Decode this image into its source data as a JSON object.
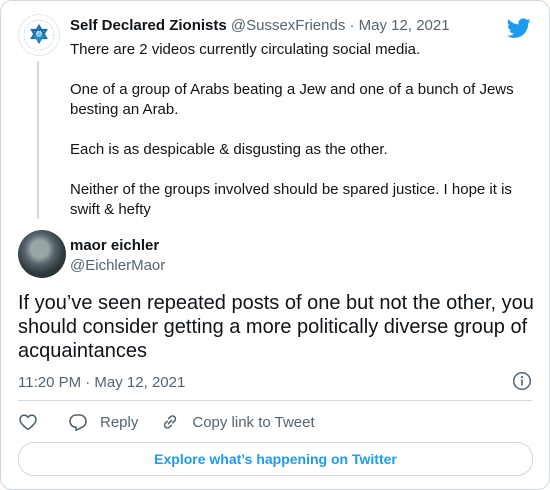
{
  "parent_tweet": {
    "display_name": "Self Declared Zionists",
    "handle": "@SussexFriends",
    "separator": "·",
    "date": "May 12, 2021",
    "avatar_icon": "star-of-david-logo",
    "paragraphs": [
      "There are 2 videos currently circulating social media.",
      "One of a group of Arabs beating a Jew and one of a bunch of Jews besting an Arab.",
      "Each is as despicable & disgusting as the other.",
      "Neither of the groups involved should be spared justice.  I hope it is swift & hefty"
    ]
  },
  "main_tweet": {
    "display_name": "maor eichler",
    "handle": "@EichlerMaor",
    "text": "If you’ve seen repeated posts of one but not the other, you should consider getting a more politically diverse group of acquaintances",
    "timestamp": "11:20 PM · May 12, 2021"
  },
  "actions": {
    "reply_label": "Reply",
    "copy_link_label": "Copy link to Tweet"
  },
  "explore_label": "Explore what’s happening on Twitter",
  "colors": {
    "accent": "#1d9bf0",
    "text_primary": "#0f1419",
    "text_secondary": "#536471",
    "border": "#cfd9de"
  },
  "icons": [
    "twitter-bird-icon",
    "info-icon",
    "heart-icon",
    "reply-icon",
    "link-icon"
  ]
}
